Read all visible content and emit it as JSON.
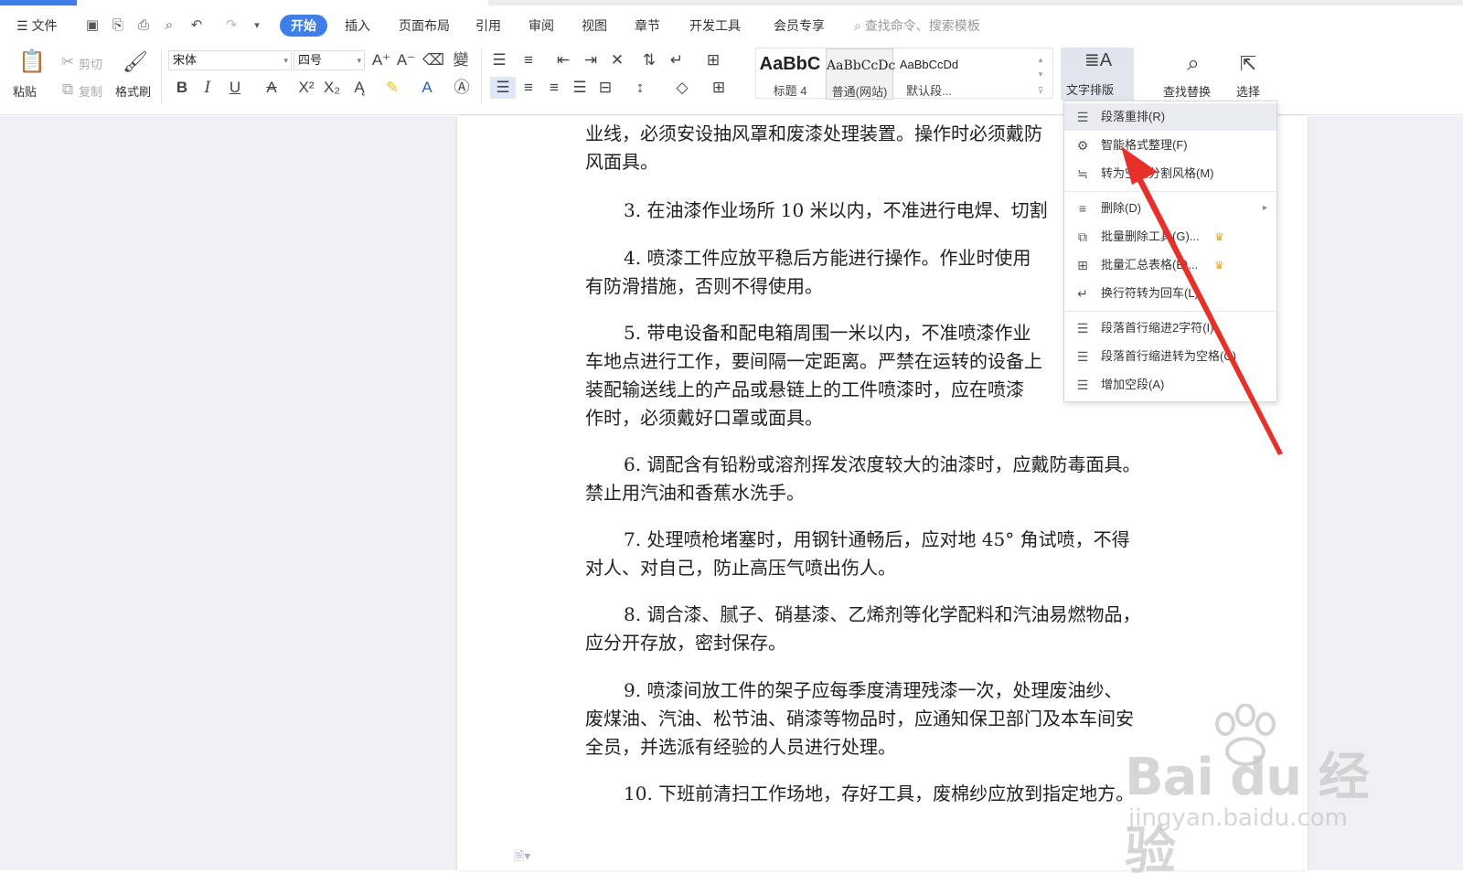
{
  "menubar": {
    "file": "文件",
    "tabs": [
      "开始",
      "插入",
      "页面布局",
      "引用",
      "审阅",
      "视图",
      "章节",
      "开发工具",
      "会员专享"
    ],
    "active_tab": "开始",
    "search_placeholder": "查找命令、搜索模板"
  },
  "ribbon": {
    "paste": "粘贴",
    "cut": "剪切",
    "copy": "复制",
    "format_painter": "格式刷",
    "font_name": "宋体",
    "font_size": "四号",
    "styles": [
      {
        "sample": "AaBbC",
        "name": "标题 4"
      },
      {
        "sample": "AaBbCcDc",
        "name": "普通(网站)"
      },
      {
        "sample": "AaBbCcDd",
        "name": "默认段..."
      }
    ],
    "typeset": "文字排版",
    "find_replace": "查找替换",
    "select": "选择"
  },
  "dropdown": {
    "items": [
      {
        "label": "段落重排(R)",
        "icon": "paragraph-rearrange-icon"
      },
      {
        "label": "智能格式整理(F)",
        "icon": "smart-format-icon"
      },
      {
        "label": "转为空段分割风格(M)",
        "icon": "empty-paragraph-split-icon"
      },
      {
        "label": "删除(D)",
        "icon": "delete-icon"
      },
      {
        "label": "批量删除工具(G)...",
        "icon": "batch-delete-icon"
      },
      {
        "label": "批量汇总表格(B)...",
        "icon": "batch-table-icon"
      },
      {
        "label": "换行符转为回车(L)",
        "icon": "linebreak-to-return-icon"
      },
      {
        "label": "段落首行缩进2字符(I)",
        "icon": "indent-two-chars-icon"
      },
      {
        "label": "段落首行缩进转为空格(C)",
        "icon": "indent-to-space-icon"
      },
      {
        "label": "增加空段(A)",
        "icon": "add-empty-paragraph-icon"
      }
    ]
  },
  "document": {
    "paragraphs": [
      {
        "lines": [
          "业线，必须安设抽风罩和废漆处理装置。操作时必须戴防",
          "风面具。"
        ]
      },
      {
        "lines": [
          "3. 在油漆作业场所 10 米以内，不准进行电焊、切割"
        ]
      },
      {
        "lines": [
          "4. 喷漆工件应放平稳后方能进行操作。作业时使用",
          "有防滑措施，否则不得使用。"
        ]
      },
      {
        "lines": [
          "5. 带电设备和配电箱周围一米以内，不准喷漆作业",
          "车地点进行工作，要间隔一定距离。严禁在运转的设备上",
          "装配输送线上的产品或悬链上的工件喷漆时，应在喷漆",
          "作时，必须戴好口罩或面具。"
        ]
      },
      {
        "lines": [
          "6. 调配含有铅粉或溶剂挥发浓度较大的油漆时，应戴防毒面具。",
          "禁止用汽油和香蕉水洗手。"
        ]
      },
      {
        "lines": [
          "7. 处理喷枪堵塞时，用钢针通畅后，应对地 45° 角试喷，不得",
          "对人、对自己，防止高压气喷出伤人。"
        ]
      },
      {
        "lines": [
          "8. 调合漆、腻子、硝基漆、乙烯剂等化学配料和汽油易燃物品，",
          "应分开存放，密封保存。"
        ]
      },
      {
        "lines": [
          "9. 喷漆间放工件的架子应每季度清理残漆一次，处理废油纱、",
          "废煤油、汽油、松节油、硝漆等物品时，应通知保卫部门及本车间安",
          "全员，并选派有经验的人员进行处理。"
        ]
      },
      {
        "lines": [
          "10. 下班前清扫工作场地，存好工具，废棉纱应放到指定地方。"
        ]
      }
    ]
  },
  "watermark": {
    "logo": "Bai du 经验",
    "url": "jingyan.baidu.com"
  },
  "colors": {
    "accent": "#3d7ee8",
    "arrow": "#e8302a",
    "crown": "#f2a30f"
  }
}
